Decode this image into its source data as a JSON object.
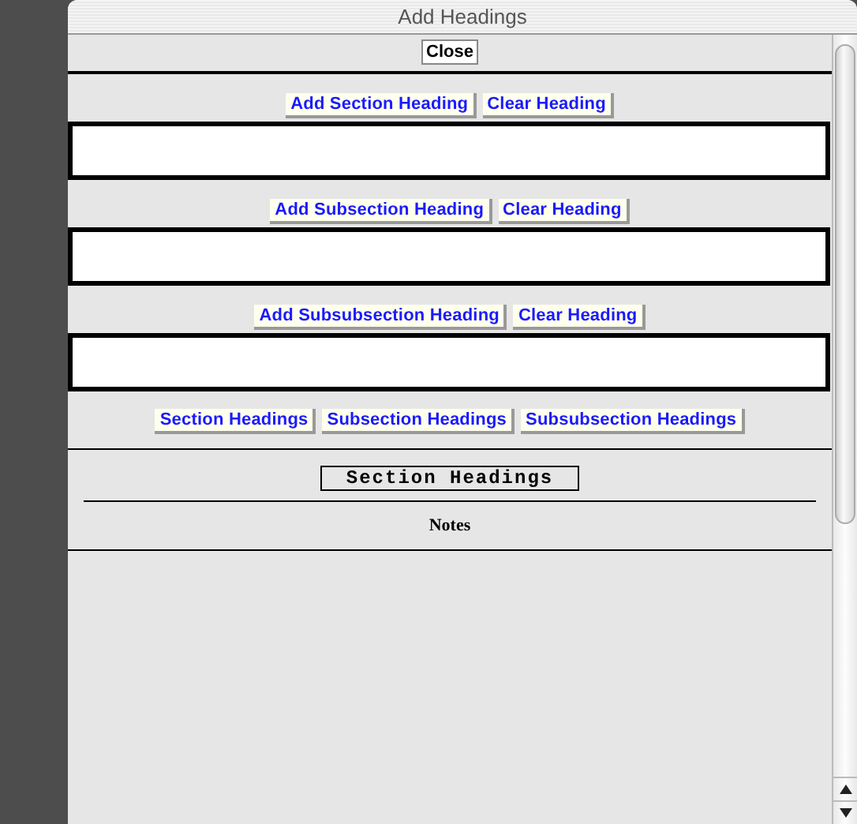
{
  "window": {
    "title": "Add Headings"
  },
  "close_button": "Close",
  "editors": [
    {
      "add_button": "Add Section Heading",
      "clear_button": "Clear Heading"
    },
    {
      "add_button": "Add Subsection Heading",
      "clear_button": "Clear Heading"
    },
    {
      "add_button": "Add Subsubsection Heading",
      "clear_button": "Clear Heading"
    }
  ],
  "view_buttons": [
    "Section Headings",
    "Subsection Headings",
    "Subsubsection Headings"
  ],
  "current_view": {
    "title": "Section Headings"
  },
  "notes_label": "Notes"
}
